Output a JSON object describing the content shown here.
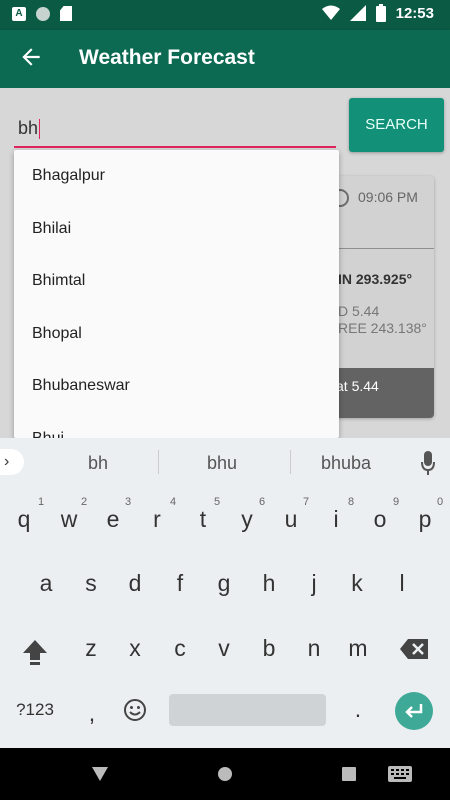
{
  "status_bar": {
    "time": "12:53",
    "icons": [
      "a-notification-icon",
      "circle-notification-icon",
      "sd-card-icon",
      "wifi-icon",
      "signal-icon",
      "battery-icon"
    ]
  },
  "app_bar": {
    "title": "Weather Forecast",
    "back_icon": "arrow-left-icon",
    "color": "#0b6a51"
  },
  "search": {
    "value": "bh",
    "button_label": "SEARCH",
    "accent": "#e0245e",
    "button_color": "#129178"
  },
  "suggestions_dropdown": {
    "items": [
      "Bhagalpur",
      "Bhilai",
      "Bhimtal",
      "Bhopal",
      "Bhubaneswar",
      "Bhuj"
    ]
  },
  "weather_card": {
    "time": "09:06 PM",
    "temp_line": "IN 293.925°",
    "line1": "D 5.44",
    "line2": "REE 243.138°",
    "footer": "at 5.44"
  },
  "keyboard": {
    "suggestions": [
      "bh",
      "bhu",
      "bhuba"
    ],
    "row1": [
      "q",
      "w",
      "e",
      "r",
      "t",
      "y",
      "u",
      "i",
      "o",
      "p"
    ],
    "row1_hints": [
      "1",
      "2",
      "3",
      "4",
      "5",
      "6",
      "7",
      "8",
      "9",
      "0"
    ],
    "row2": [
      "a",
      "s",
      "d",
      "f",
      "g",
      "h",
      "j",
      "k",
      "l"
    ],
    "row3": [
      "z",
      "x",
      "c",
      "v",
      "b",
      "n",
      "m"
    ],
    "symbols_key": "?123",
    "comma": ",",
    "period": ".",
    "emoji_icon": "emoji-icon",
    "shift_icon": "shift-icon",
    "backspace_icon": "backspace-icon",
    "enter_icon": "enter-icon",
    "mic_icon": "mic-icon"
  },
  "nav_bar": {
    "icons": [
      "back-triangle-icon",
      "home-circle-icon",
      "recents-square-icon",
      "keyboard-switch-icon"
    ]
  }
}
